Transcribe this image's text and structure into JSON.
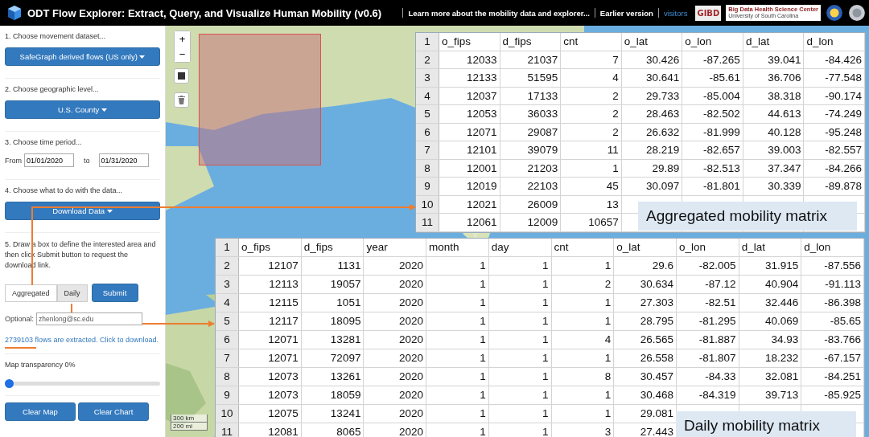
{
  "header": {
    "title": "ODT Flow Explorer: Extract, Query, and Visualize Human Mobility (v0.6)",
    "links": [
      "Learn more about the mobility data and explorer...",
      "Earlier version",
      "visitors"
    ],
    "logos": [
      {
        "kind": "text",
        "label": "GIBD"
      },
      {
        "kind": "center",
        "label": "Big Data Health Science Center",
        "sub": "University of South Carolina"
      },
      {
        "kind": "seal"
      },
      {
        "kind": "seal"
      }
    ]
  },
  "sidebar": {
    "steps": [
      {
        "kind": "dropdown",
        "label": "1. Choose movement dataset...",
        "button": "SafeGraph derived flows (US only)"
      },
      {
        "kind": "dropdown",
        "label": "2. Choose geographic level...",
        "button": "U.S. County"
      },
      {
        "kind": "dates",
        "label": "3. Choose time period...",
        "from_label": "From",
        "from": "01/01/2020",
        "to_label": "to",
        "to": "01/31/2020"
      },
      {
        "kind": "dropdown",
        "label": "4. Choose what to do with the data...",
        "button": "Download Data"
      },
      {
        "kind": "download",
        "label": "5. Draw a box to define the interested area and then click Submit button to request the download link.",
        "toggles": [
          {
            "label": "Aggregated",
            "selected": false
          },
          {
            "label": "Daily",
            "selected": true
          }
        ],
        "submit": "Submit",
        "email_label": "Optional:",
        "email_placeholder": "zhenlong@sc.edu",
        "result_link": "2739103 flows are extracted. Click to download."
      },
      {
        "kind": "slider",
        "label": "Map transparency 0%",
        "level": 0
      },
      {
        "kind": "buttons",
        "buttons": [
          "Clear Map",
          "Clear Chart"
        ]
      }
    ]
  },
  "map": {
    "kind": "picture",
    "zoom_buttons": [
      "+",
      "−"
    ],
    "scale": [
      "300 km",
      "200 mi"
    ]
  },
  "aggregated_table": {
    "caption": "Aggregated mobility matrix",
    "header_number": "1",
    "columns": [
      "o_fips",
      "d_fips",
      "cnt",
      "o_lat",
      "o_lon",
      "d_lat",
      "d_lon"
    ],
    "rows": [
      {
        "n": "2",
        "cells": [
          "12033",
          "21037",
          "7",
          "30.426",
          "-87.265",
          "39.041",
          "-84.426"
        ]
      },
      {
        "n": "3",
        "cells": [
          "12133",
          "51595",
          "4",
          "30.641",
          "-85.61",
          "36.706",
          "-77.548"
        ]
      },
      {
        "n": "4",
        "cells": [
          "12037",
          "17133",
          "2",
          "29.733",
          "-85.004",
          "38.318",
          "-90.174"
        ]
      },
      {
        "n": "5",
        "cells": [
          "12053",
          "36033",
          "2",
          "28.463",
          "-82.502",
          "44.613",
          "-74.249"
        ]
      },
      {
        "n": "6",
        "cells": [
          "12071",
          "29087",
          "2",
          "26.632",
          "-81.999",
          "40.128",
          "-95.248"
        ]
      },
      {
        "n": "7",
        "cells": [
          "12101",
          "39079",
          "11",
          "28.219",
          "-82.657",
          "39.003",
          "-82.557"
        ]
      },
      {
        "n": "8",
        "cells": [
          "12001",
          "21203",
          "1",
          "29.89",
          "-82.513",
          "37.347",
          "-84.266"
        ]
      },
      {
        "n": "9",
        "cells": [
          "12019",
          "22103",
          "45",
          "30.097",
          "-81.801",
          "30.339",
          "-89.878"
        ]
      },
      {
        "n": "10",
        "cells": [
          "12021",
          "26009",
          "13"
        ]
      },
      {
        "n": "11",
        "cells": [
          "12061",
          "12009",
          "10657"
        ]
      }
    ]
  },
  "daily_table": {
    "caption": "Daily mobility matrix",
    "header_number": "1",
    "columns": [
      "o_fips",
      "d_fips",
      "year",
      "month",
      "day",
      "cnt",
      "o_lat",
      "o_lon",
      "d_lat",
      "d_lon"
    ],
    "rows": [
      {
        "n": "2",
        "cells": [
          "12107",
          "1131",
          "2020",
          "1",
          "1",
          "1",
          "29.6",
          "-82.005",
          "31.915",
          "-87.556"
        ]
      },
      {
        "n": "3",
        "cells": [
          "12113",
          "19057",
          "2020",
          "1",
          "1",
          "2",
          "30.634",
          "-87.12",
          "40.904",
          "-91.113"
        ]
      },
      {
        "n": "4",
        "cells": [
          "12115",
          "1051",
          "2020",
          "1",
          "1",
          "1",
          "27.303",
          "-82.51",
          "32.446",
          "-86.398"
        ]
      },
      {
        "n": "5",
        "cells": [
          "12117",
          "18095",
          "2020",
          "1",
          "1",
          "1",
          "28.795",
          "-81.295",
          "40.069",
          "-85.65"
        ]
      },
      {
        "n": "6",
        "cells": [
          "12071",
          "13281",
          "2020",
          "1",
          "1",
          "4",
          "26.565",
          "-81.887",
          "34.93",
          "-83.766"
        ]
      },
      {
        "n": "7",
        "cells": [
          "12071",
          "72097",
          "2020",
          "1",
          "1",
          "1",
          "26.558",
          "-81.807",
          "18.232",
          "-67.157"
        ]
      },
      {
        "n": "8",
        "cells": [
          "12073",
          "13261",
          "2020",
          "1",
          "1",
          "8",
          "30.457",
          "-84.33",
          "32.081",
          "-84.251"
        ]
      },
      {
        "n": "9",
        "cells": [
          "12073",
          "18059",
          "2020",
          "1",
          "1",
          "1",
          "30.468",
          "-84.319",
          "39.713",
          "-85.925"
        ]
      },
      {
        "n": "10",
        "cells": [
          "12075",
          "13241",
          "2020",
          "1",
          "1",
          "1",
          "29.081"
        ]
      },
      {
        "n": "11",
        "cells": [
          "12081",
          "8065",
          "2020",
          "1",
          "1",
          "3",
          "27.443"
        ]
      }
    ]
  }
}
